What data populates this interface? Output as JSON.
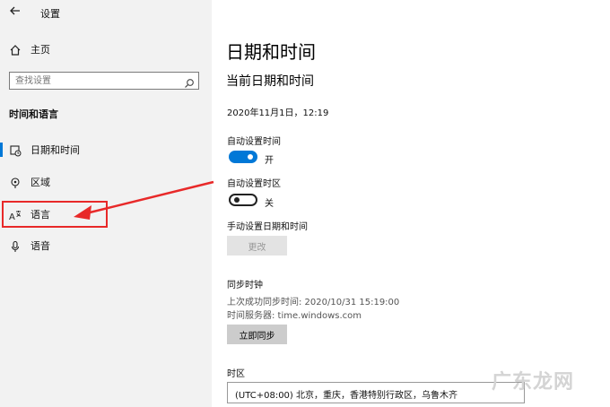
{
  "window": {
    "title": "设置"
  },
  "sidebar": {
    "home_label": "主页",
    "search_placeholder": "查找设置",
    "section_title": "时间和语言",
    "items": [
      {
        "label": "日期和时间",
        "icon": "calendar-clock-icon",
        "active": true
      },
      {
        "label": "区域",
        "icon": "globe-icon"
      },
      {
        "label": "语言",
        "icon": "language-icon"
      },
      {
        "label": "语音",
        "icon": "microphone-icon"
      }
    ]
  },
  "main": {
    "title": "日期和时间",
    "subtitle": "当前日期和时间",
    "current_datetime": "2020年11月1日，12:19",
    "auto_time": {
      "label": "自动设置时间",
      "state_text": "开",
      "on": true
    },
    "auto_timezone": {
      "label": "自动设置时区",
      "state_text": "关",
      "on": false
    },
    "manual": {
      "label": "手动设置日期和时间",
      "button": "更改"
    },
    "sync": {
      "title": "同步时钟",
      "last_sync": "上次成功同步时间: 2020/10/31 15:19:00",
      "server": "时间服务器: time.windows.com",
      "button": "立即同步"
    },
    "timezone": {
      "label": "时区",
      "value": "(UTC+08:00) 北京，重庆，香港特别行政区，乌鲁木齐"
    }
  },
  "watermark": "广东龙网",
  "colors": {
    "accent": "#0078d7",
    "highlight_red": "#e82929"
  }
}
